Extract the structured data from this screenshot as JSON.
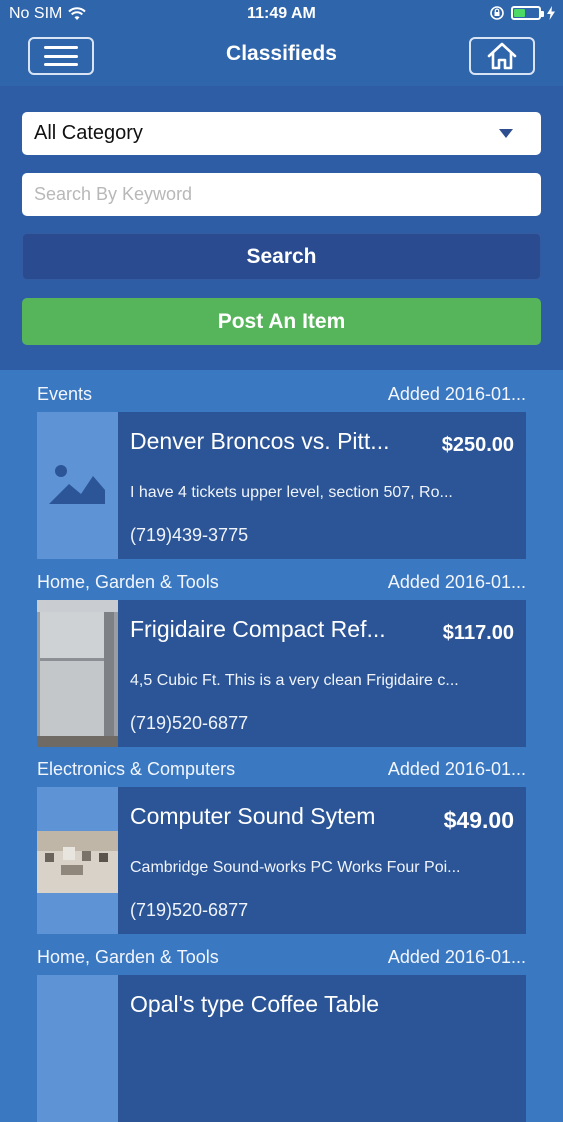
{
  "status": {
    "carrier": "No SIM",
    "time": "11:49 AM",
    "battery_level": 0.45
  },
  "nav": {
    "title": "Classifieds",
    "menu_icon": "menu-icon",
    "home_icon": "home-icon"
  },
  "search_panel": {
    "category_selected": "All Category",
    "keyword_placeholder": "Search By Keyword",
    "search_label": "Search",
    "post_label": "Post An Item"
  },
  "listings": [
    {
      "category": "Events",
      "date": "Added 2016-01...",
      "title": "Denver Broncos vs. Pitt...",
      "price": "$250.00",
      "description": "I have 4 tickets upper level, section 507, Ro...",
      "phone": "(719)439-3775",
      "thumb": "image-placeholder-icon"
    },
    {
      "category": "Home, Garden & Tools",
      "date": "Added 2016-01...",
      "title": "Frigidaire Compact Ref...",
      "price": "$117.00",
      "description": "4,5 Cubic Ft. This is a very clean Frigidaire c...",
      "phone": "(719)520-6877",
      "thumb": "fridge-photo"
    },
    {
      "category": "Electronics & Computers",
      "date": "Added 2016-01...",
      "title": "Computer Sound Sytem",
      "price": "$49.00",
      "description": "Cambridge Sound-works PC Works Four Poi...",
      "phone": "(719)520-6877",
      "thumb": "speakers-photo"
    },
    {
      "category": "Home, Garden & Tools",
      "date": "Added 2016-01...",
      "title": "Opal's type Coffee Table",
      "price": "",
      "description": "",
      "phone": "",
      "thumb": ""
    }
  ]
}
